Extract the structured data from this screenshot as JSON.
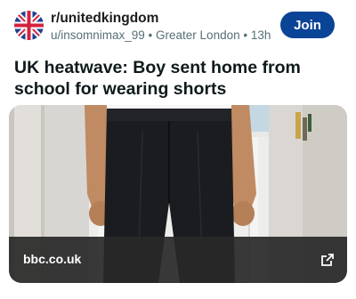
{
  "post": {
    "subreddit": "r/unitedkingdom",
    "meta": "u/insomnimax_99 • Greater London • 13h",
    "join_label": "Join",
    "title": "UK heatwave: Boy sent home from school for wearing shorts"
  },
  "link": {
    "domain": "bbc.co.uk"
  },
  "icons": {
    "avatar": "union-jack-flag",
    "external": "external-link-icon"
  },
  "colors": {
    "join_button": "#0a4496",
    "meta_text": "#576f76"
  }
}
